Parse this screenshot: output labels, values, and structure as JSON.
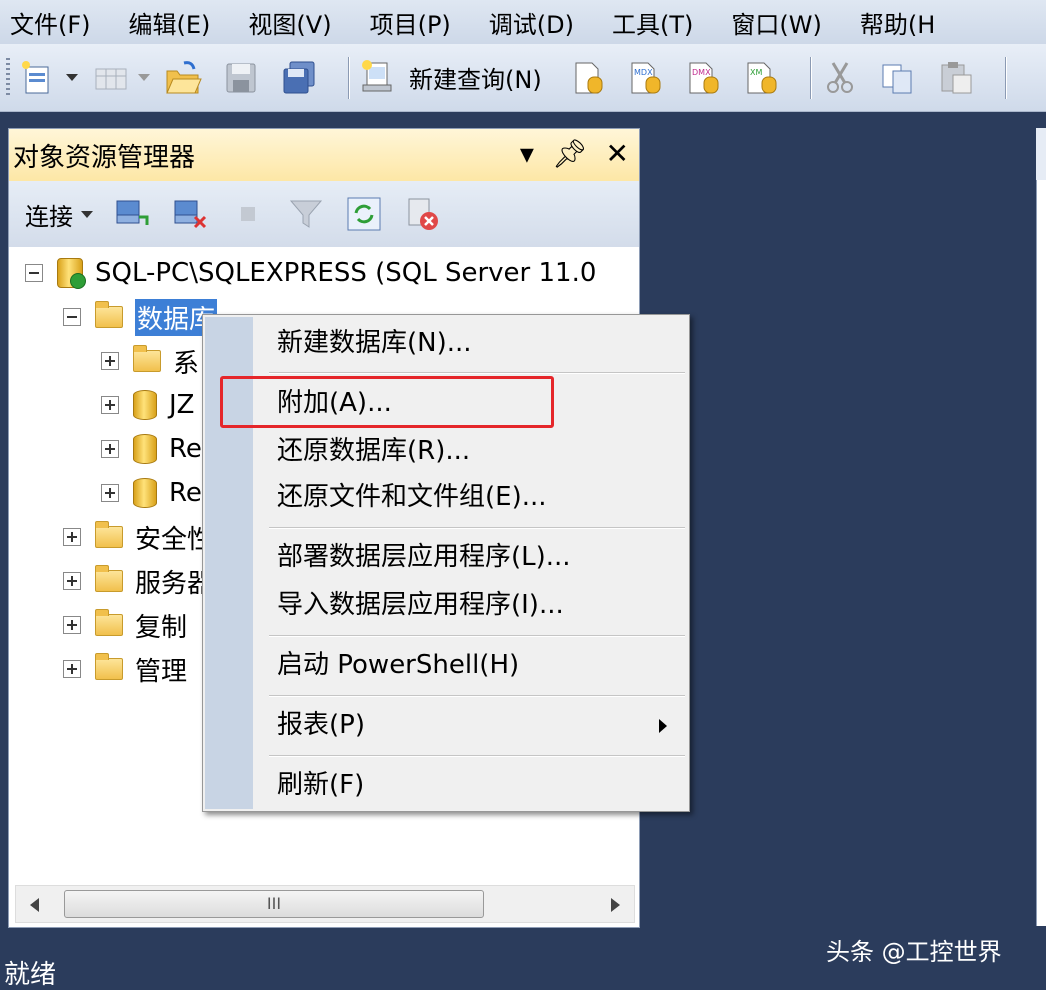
{
  "menubar": {
    "items": [
      "文件(F)",
      "编辑(E)",
      "视图(V)",
      "项目(P)",
      "调试(D)",
      "工具(T)",
      "窗口(W)",
      "帮助(H"
    ]
  },
  "toolbar": {
    "new_query_label": "新建查询(N)",
    "icons": [
      "new-project-icon",
      "add-item-icon",
      "open-file-icon",
      "save-icon",
      "save-all-icon",
      "new-query-icon",
      "database-engine-query-icon",
      "mdx-query-icon",
      "dmx-query-icon",
      "xmla-query-icon",
      "cut-icon",
      "copy-icon",
      "paste-icon"
    ]
  },
  "object_explorer": {
    "title": "对象资源管理器",
    "connect_label": "连接",
    "tree": {
      "server": "SQL-PC\\SQLEXPRESS (SQL Server 11.0",
      "databases_label": "数据库",
      "databases_children": [
        "系",
        "JZ",
        "Re",
        "Re"
      ],
      "others": [
        "安全性",
        "服务器",
        "复制",
        "管理"
      ]
    },
    "scrollbar_thumb_label": "III"
  },
  "context_menu": {
    "items": [
      "新建数据库(N)...",
      "附加(A)...",
      "还原数据库(R)...",
      "还原文件和文件组(E)...",
      "部署数据层应用程序(L)...",
      "导入数据层应用程序(I)...",
      "启动 PowerShell(H)",
      "报表(P)",
      "刷新(F)"
    ]
  },
  "status": {
    "text": "就绪"
  },
  "watermark": "头条 @工控世界",
  "colors": {
    "highlight": "#e5262a",
    "selection": "#3d7fd6",
    "background": "#2b3c5c",
    "title_bar": "#fde7a6"
  }
}
